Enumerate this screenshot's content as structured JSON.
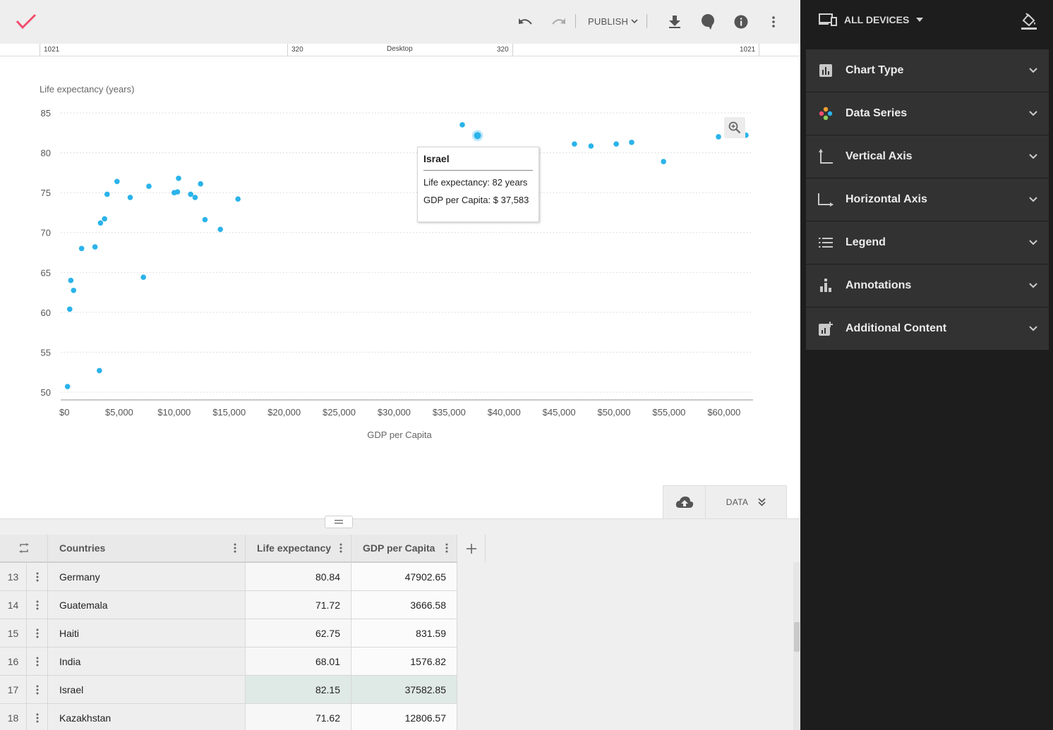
{
  "toolbar": {
    "publish_label": "PUBLISH",
    "accent_color": "#f04e6e"
  },
  "ruler": {
    "left_outer": "1021",
    "left_inner": "320",
    "center": "Desktop",
    "right_inner": "320",
    "right_outer": "1021"
  },
  "chart_data": {
    "type": "scatter",
    "ylabel": "Life expectancy (years)",
    "xlabel": "GDP per Capita",
    "xlim": [
      0,
      62000
    ],
    "ylim": [
      50,
      85
    ],
    "x_ticks": [
      "$0",
      "$5,000",
      "$10,000",
      "$15,000",
      "$20,000",
      "$25,000",
      "$30,000",
      "$35,000",
      "$40,000",
      "$45,000",
      "$50,000",
      "$55,000",
      "$60,000"
    ],
    "y_ticks": [
      "50",
      "55",
      "60",
      "65",
      "70",
      "75",
      "80",
      "85"
    ],
    "grid": true,
    "point_color": "#2ab3ea",
    "points": [
      [
        300,
        50.7
      ],
      [
        3200,
        52.7
      ],
      [
        500,
        60.4
      ],
      [
        850,
        62.75
      ],
      [
        600,
        64.0
      ],
      [
        7200,
        64.4
      ],
      [
        1580,
        68.0
      ],
      [
        2800,
        68.2
      ],
      [
        3300,
        71.2
      ],
      [
        3670,
        71.72
      ],
      [
        12800,
        71.62
      ],
      [
        14200,
        70.4
      ],
      [
        3900,
        74.8
      ],
      [
        6000,
        74.4
      ],
      [
        4800,
        76.4
      ],
      [
        7700,
        75.8
      ],
      [
        10000,
        75.0
      ],
      [
        10300,
        75.1
      ],
      [
        10400,
        76.8
      ],
      [
        11500,
        74.8
      ],
      [
        11900,
        74.4
      ],
      [
        12400,
        76.1
      ],
      [
        15800,
        74.2
      ],
      [
        36200,
        83.5
      ],
      [
        37583,
        82.15
      ],
      [
        46400,
        81.1
      ],
      [
        47903,
        80.84
      ],
      [
        50200,
        81.1
      ],
      [
        51600,
        81.3
      ],
      [
        54500,
        78.9
      ],
      [
        59500,
        82.0
      ],
      [
        62000,
        82.2
      ]
    ],
    "highlight_index": 24
  },
  "tooltip": {
    "title": "Israel",
    "line1": "Life expectancy: 82 years",
    "line2": "GDP per Capita: $ 37,583"
  },
  "data_tab": {
    "label": "DATA"
  },
  "table": {
    "headers": [
      "Countries",
      "Life expectancy",
      "GDP per Capita"
    ],
    "rows": [
      {
        "num": "13",
        "country": "Germany",
        "life": "80.84",
        "gdp": "47902.65"
      },
      {
        "num": "14",
        "country": "Guatemala",
        "life": "71.72",
        "gdp": "3666.58"
      },
      {
        "num": "15",
        "country": "Haiti",
        "life": "62.75",
        "gdp": "831.59"
      },
      {
        "num": "16",
        "country": "India",
        "life": "68.01",
        "gdp": "1576.82"
      },
      {
        "num": "17",
        "country": "Israel",
        "life": "82.15",
        "gdp": "37582.85"
      },
      {
        "num": "18",
        "country": "Kazakhstan",
        "life": "71.62",
        "gdp": "12806.57"
      }
    ],
    "selected_row": 4
  },
  "panel": {
    "devices_label": "ALL DEVICES",
    "sections": [
      {
        "label": "Chart Type",
        "icon": "bar-chart-icon"
      },
      {
        "label": "Data Series",
        "icon": "palette-dots-icon"
      },
      {
        "label": "Vertical Axis",
        "icon": "vertical-axis-icon"
      },
      {
        "label": "Horizontal Axis",
        "icon": "horizontal-axis-icon"
      },
      {
        "label": "Legend",
        "icon": "list-icon"
      },
      {
        "label": "Annotations",
        "icon": "annotation-bars-icon"
      },
      {
        "label": "Additional Content",
        "icon": "add-content-icon"
      }
    ]
  }
}
